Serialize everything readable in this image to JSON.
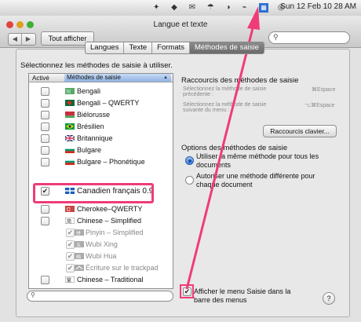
{
  "menubar": {
    "kbd_icon": "keyboard-flag-icon",
    "status": "Sun 12 Feb  10 28 AM"
  },
  "window": {
    "title": "Langue et texte",
    "nav_back": "◀",
    "nav_fwd": "▶",
    "show_all": "Tout afficher",
    "search_placeholder": ""
  },
  "tabs": [
    {
      "label": "Langues"
    },
    {
      "label": "Texte"
    },
    {
      "label": "Formats"
    },
    {
      "label": "Méthodes de saisie"
    }
  ],
  "instruction": "Sélectionnez les méthodes de saisie à utiliser.",
  "list": {
    "col_active": "Activé",
    "col_method": "Méthodes de saisie",
    "rows": [
      {
        "label": "Bengali",
        "checked": false,
        "dim": false
      },
      {
        "label": "Bengali – QWERTY",
        "checked": false,
        "dim": false
      },
      {
        "label": "Biélorusse",
        "checked": false,
        "dim": false
      },
      {
        "label": "Brésilien",
        "checked": false,
        "dim": false
      },
      {
        "label": "Britannique",
        "checked": false,
        "dim": false
      },
      {
        "label": "Bulgare",
        "checked": false,
        "dim": false
      },
      {
        "label": "Bulgare – Phonétique",
        "checked": false,
        "dim": false
      },
      {
        "label": "Canadien français 0.9",
        "checked": true,
        "dim": false
      },
      {
        "label": "Cherokee–QWERTY",
        "checked": false,
        "dim": false
      },
      {
        "label": "Chinese – Simplified",
        "checked": false,
        "dim": false
      },
      {
        "label": "Pinyin – Simplified",
        "checked": true,
        "dim": true
      },
      {
        "label": "Wubi Xing",
        "checked": true,
        "dim": true
      },
      {
        "label": "Wubi Hua",
        "checked": true,
        "dim": true
      },
      {
        "label": "Écriture sur le trackpad",
        "checked": true,
        "dim": true
      },
      {
        "label": "Chinese – Traditional",
        "checked": false,
        "dim": false
      }
    ]
  },
  "shortcuts": {
    "heading": "Raccourcis des méthodes de saisie",
    "prev_label": "Sélectionnez la méthode de saisie précédente :",
    "prev_key": "⌘Espace",
    "next_label": "Sélectionnez la méthode de saisie suivante du menu :",
    "next_key": "⌥⌘Espace",
    "button": "Raccourcis clavier..."
  },
  "options": {
    "heading": "Options des méthodes de saisie",
    "opt1": "Utiliser la même méthode pour tous les documents",
    "opt2": "Autoriser une méthode différente pour chaque document"
  },
  "show_menu": {
    "label": "Afficher le menu Saisie dans la barre des menus",
    "checked": true
  },
  "help": "?",
  "colors": {
    "highlight": "#ef3c78",
    "selected_tab": "#7a7a7a",
    "accent": "#3a7ed8"
  }
}
